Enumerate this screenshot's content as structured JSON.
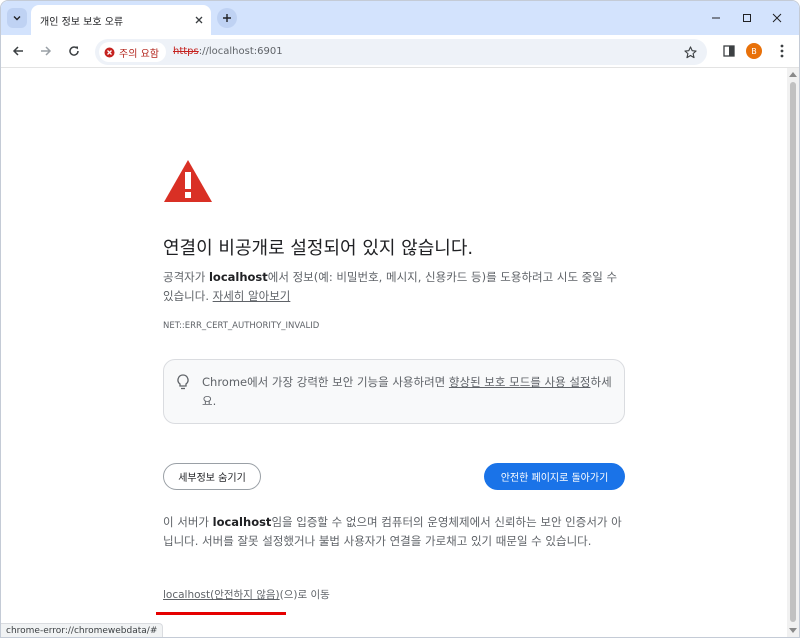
{
  "tab": {
    "title": "개인 정보 보호 오류"
  },
  "toolbar": {
    "security_chip": "주의 요함",
    "url_scheme": "https",
    "url_rest": "://localhost:6901",
    "avatar_letter": "B"
  },
  "icons": {
    "warning": "warning-triangle-icon",
    "bulb": "lightbulb-icon"
  },
  "colors": {
    "warning_red": "#d93025",
    "primary_blue": "#1a73e8",
    "highlight_red": "#e50000"
  },
  "page": {
    "heading": "연결이 비공개로 설정되어 있지 않습니다.",
    "desc_pre": "공격자가 ",
    "desc_host": "localhost",
    "desc_post": "에서 정보(예: 비밀번호, 메시지, 신용카드 등)를 도용하려고 시도 중일 수 있습니다. ",
    "desc_link": "자세히 알아보기",
    "error_code": "NET::ERR_CERT_AUTHORITY_INVALID",
    "box_pre": "Chrome에서 가장 강력한 보안 기능을 사용하려면 ",
    "box_link": "향상된 보호 모드를 사용 설정",
    "box_post": "하세요.",
    "hide_details_button": "세부정보 숨기기",
    "back_button": "안전한 페이지로 돌아가기",
    "details_pre": "이 서버가 ",
    "details_host": "localhost",
    "details_post": "임을 입증할 수 없으며 컴퓨터의 운영체제에서 신뢰하는 보안 인증서가 아닙니다. 서버를 잘못 설정했거나 불법 사용자가 연결을 가로채고 있기 때문일 수 있습니다.",
    "proceed_link": "localhost(안전하지 않음)",
    "proceed_suffix": "(으)로 이동"
  },
  "statusbar": {
    "text": "chrome-error://chromewebdata/#"
  }
}
